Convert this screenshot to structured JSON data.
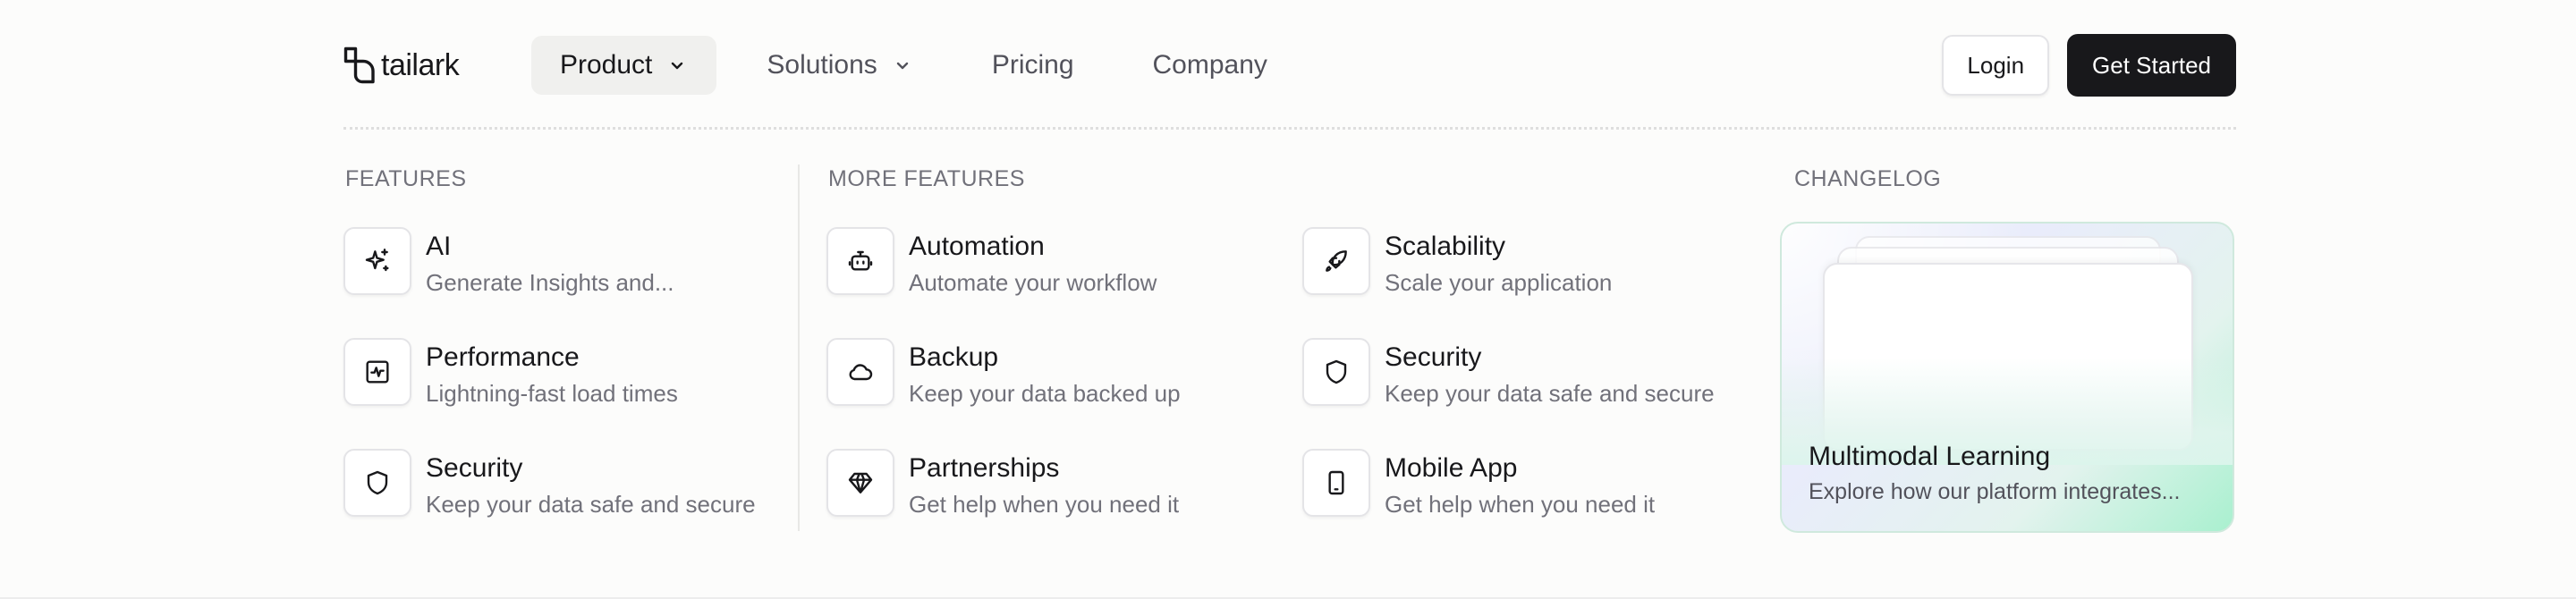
{
  "brand": {
    "name": "tailark",
    "logo_icon": "tailark-logo-icon"
  },
  "nav": {
    "items": [
      {
        "label": "Product",
        "has_dropdown": true,
        "active": true
      },
      {
        "label": "Solutions",
        "has_dropdown": true,
        "active": false
      },
      {
        "label": "Pricing",
        "has_dropdown": false,
        "active": false
      },
      {
        "label": "Company",
        "has_dropdown": false,
        "active": false
      }
    ]
  },
  "actions": {
    "login_label": "Login",
    "get_started_label": "Get Started"
  },
  "menu": {
    "features": {
      "heading": "FEATURES",
      "items": [
        {
          "title": "AI",
          "description": "Generate Insights and...",
          "icon": "sparkles-icon"
        },
        {
          "title": "Performance",
          "description": "Lightning-fast load times",
          "icon": "activity-icon"
        },
        {
          "title": "Security",
          "description": "Keep your data safe and secure",
          "icon": "shield-icon"
        }
      ]
    },
    "more_features": {
      "heading": "MORE FEATURES",
      "items": [
        {
          "title": "Automation",
          "description": "Automate your workflow",
          "icon": "bot-icon"
        },
        {
          "title": "Scalability",
          "description": "Scale your application",
          "icon": "rocket-icon"
        },
        {
          "title": "Backup",
          "description": "Keep your data backed up",
          "icon": "cloud-icon"
        },
        {
          "title": "Security",
          "description": "Keep your data safe and secure",
          "icon": "shield-icon"
        },
        {
          "title": "Partnerships",
          "description": "Get help when you need it",
          "icon": "gem-icon"
        },
        {
          "title": "Mobile App",
          "description": "Get help when you need it",
          "icon": "smartphone-icon"
        }
      ]
    },
    "changelog": {
      "heading": "CHANGELOG",
      "card_title": "Multimodal Learning",
      "card_description": "Explore how our platform integrates..."
    }
  },
  "colors": {
    "background": "#fcfcfb",
    "text_primary": "#18181b",
    "text_muted": "#71717a",
    "button_dark": "#18181b",
    "card_accent_green": "#a9f0cf"
  }
}
